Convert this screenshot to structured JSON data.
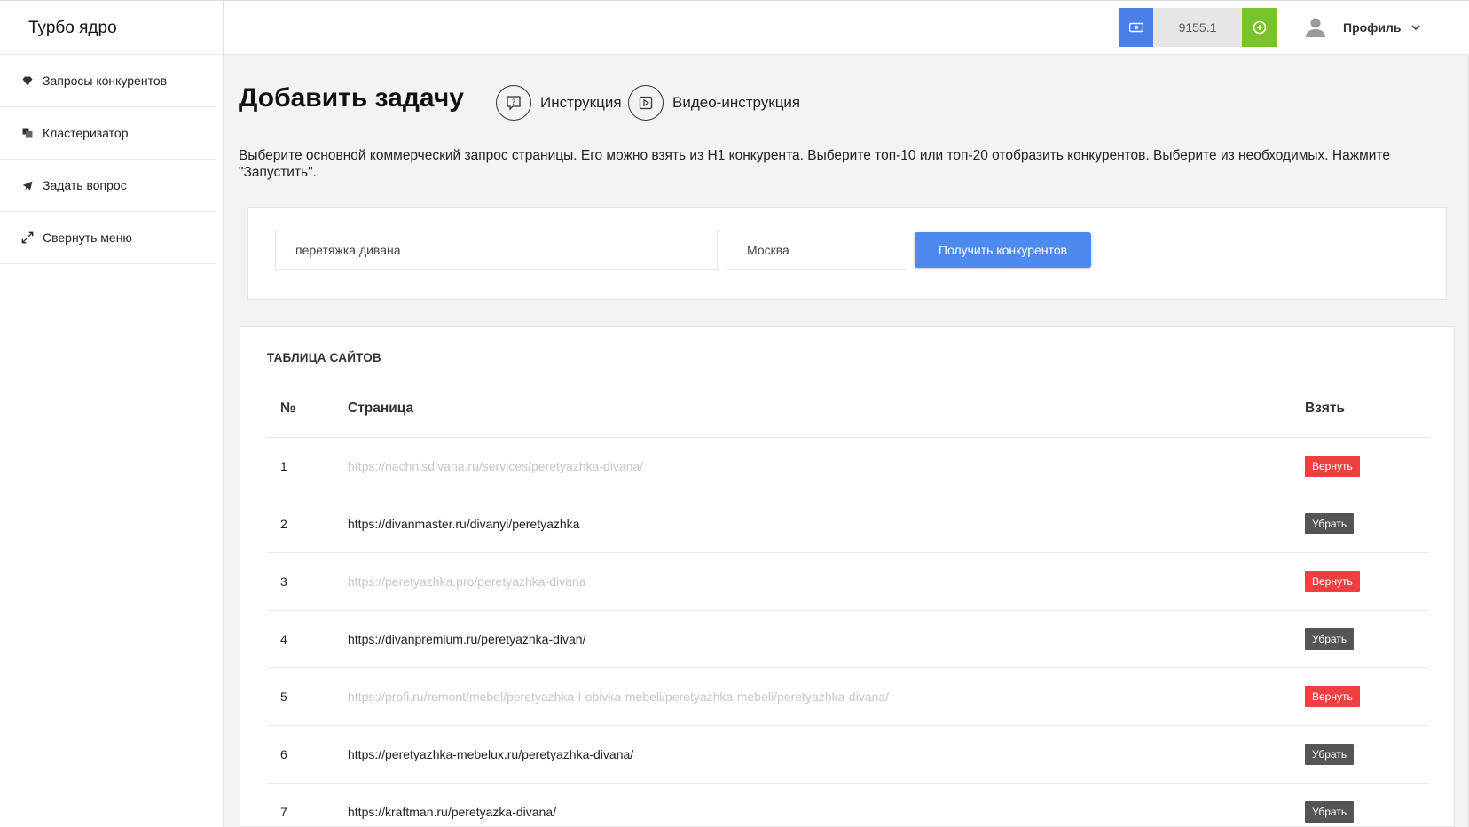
{
  "app": {
    "title": "Турбо ядро"
  },
  "header": {
    "balance": "9155.1",
    "profile_label": "Профиль",
    "colors": {
      "wallet": "#4a7ee8",
      "add": "#77c32a"
    }
  },
  "sidebar": {
    "items": [
      {
        "label": "Запросы конкурентов",
        "icon": "diamond-icon"
      },
      {
        "label": "Кластеризатор",
        "icon": "layers-icon"
      },
      {
        "label": "Задать вопрос",
        "icon": "telegram-icon"
      },
      {
        "label": "Свернуть меню",
        "icon": "expand-icon"
      }
    ]
  },
  "main": {
    "title": "Добавить задачу",
    "instruction_label": "Инструкция",
    "video_label": "Видео-инструкция",
    "description": "Выберите основной коммерческий запрос страницы. Его можно взять из H1 конкурента. Выберите топ-10 или топ-20 отобразить конкурентов. Выберите из необходимых. Нажмите \"Запустить\".",
    "form": {
      "query_value": "перетяжка дивана",
      "region_value": "Москва",
      "submit_label": "Получить конкурентов"
    },
    "table": {
      "title": "ТАБЛИЦА САЙТОВ",
      "headers": {
        "num": "№",
        "page": "Страница",
        "take": "Взять"
      },
      "rows": [
        {
          "num": "1",
          "url": "https://nachnisdivana.ru/services/peretyazhka-divana/",
          "action": "Вернуть",
          "removed": true
        },
        {
          "num": "2",
          "url": "https://divanmaster.ru/divanyi/peretyazhka",
          "action": "Убрать",
          "removed": false
        },
        {
          "num": "3",
          "url": "https://peretyazhka.pro/peretyazhka-divana",
          "action": "Вернуть",
          "removed": true
        },
        {
          "num": "4",
          "url": "https://divanpremium.ru/peretyazhka-divan/",
          "action": "Убрать",
          "removed": false
        },
        {
          "num": "5",
          "url": "https://profi.ru/remont/mebel/peretyazhka-i-obivka-mebeli/peretyazhka-mebeli/peretyazhka-divana/",
          "action": "Вернуть",
          "removed": true
        },
        {
          "num": "6",
          "url": "https://peretyazhka-mebelux.ru/peretyazhka-divana/",
          "action": "Убрать",
          "removed": false
        },
        {
          "num": "7",
          "url": "https://kraftman.ru/peretyazka-divana/",
          "action": "Убрать",
          "removed": false
        }
      ]
    }
  }
}
